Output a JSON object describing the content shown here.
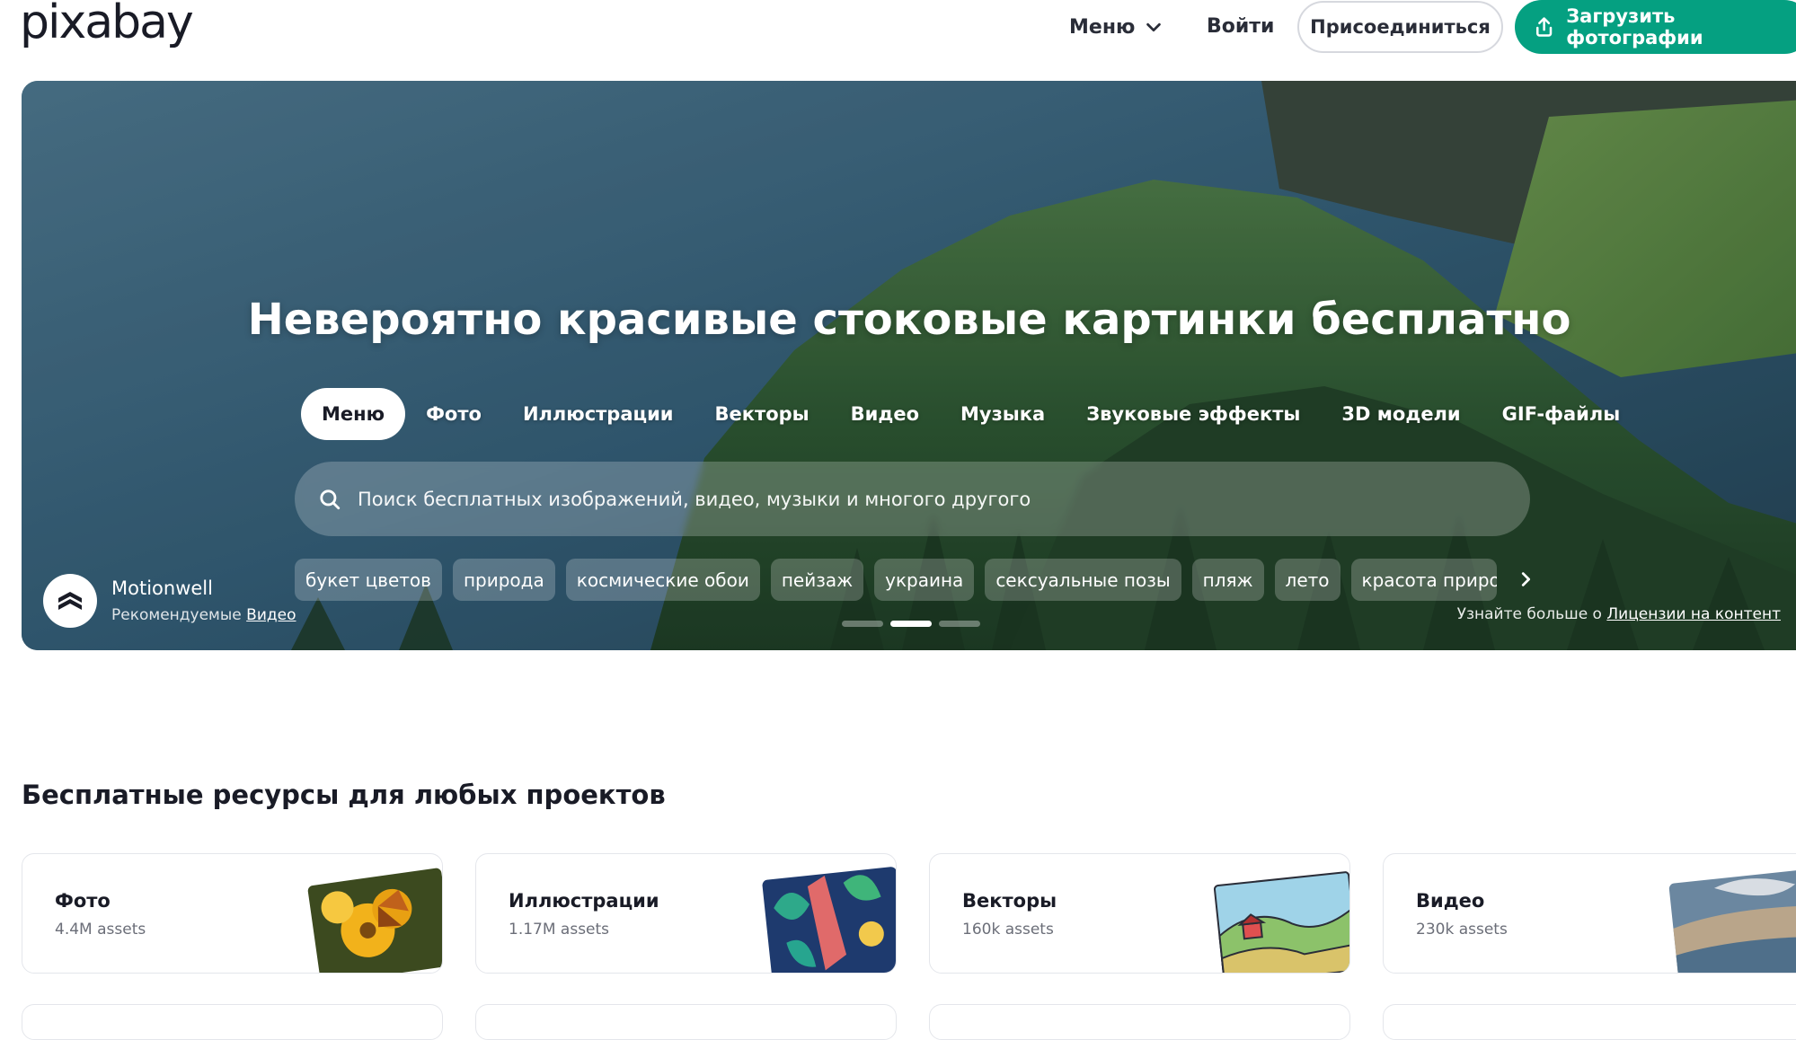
{
  "header": {
    "logo": "pixabay",
    "menu_label": "Меню",
    "login_label": "Войти",
    "join_label": "Присоединиться",
    "upload_label": "Загрузить фотографии"
  },
  "hero": {
    "title": "Невероятно красивые стоковые картинки бесплатно",
    "tabs": [
      {
        "label": "Меню",
        "active": true
      },
      {
        "label": "Фото"
      },
      {
        "label": "Иллюстрации"
      },
      {
        "label": "Векторы"
      },
      {
        "label": "Видео"
      },
      {
        "label": "Музыка"
      },
      {
        "label": "Звуковые эффекты"
      },
      {
        "label": "3D модели"
      },
      {
        "label": "GIF-файлы"
      }
    ],
    "search_placeholder": "Поиск бесплатных изображений, видео, музыки и многого другого",
    "tags": [
      "букет цветов",
      "природа",
      "космические обои",
      "пейзаж",
      "украина",
      "сексуальные позы",
      "пляж",
      "лето",
      "красота приро,"
    ],
    "author_name": "Motionwell",
    "author_prefix": "Рекомендуемые",
    "author_link": "Видео",
    "slides_total": 3,
    "slides_active": 2,
    "license_prefix": "Узнайте больше о",
    "license_link": "Лицензии на контент"
  },
  "resources": {
    "title": "Бесплатные ресурсы для любых проектов",
    "cards": [
      {
        "title": "Фото",
        "count": "4.4M assets"
      },
      {
        "title": "Иллюстрации",
        "count": "1.17M assets"
      },
      {
        "title": "Векторы",
        "count": "160k assets"
      },
      {
        "title": "Видео",
        "count": "230k assets"
      }
    ]
  },
  "colors": {
    "brand_green": "#05a081",
    "text_dark": "#191b26"
  },
  "icons": [
    "chevron-down-icon",
    "upload-icon",
    "search-icon",
    "chevron-right-icon"
  ]
}
